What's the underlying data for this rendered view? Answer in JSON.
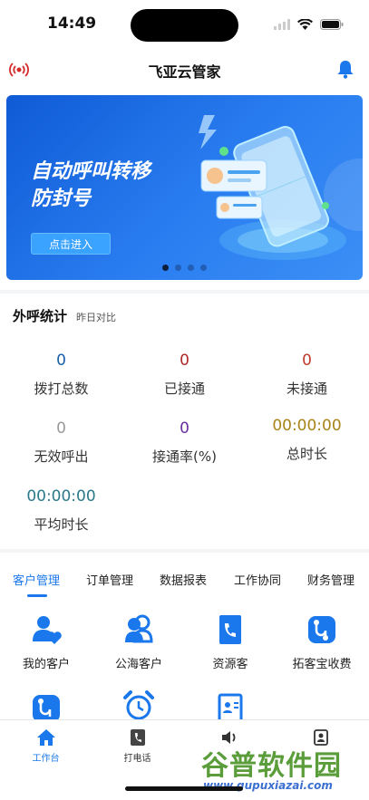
{
  "status_bar": {
    "time": "14:49"
  },
  "nav": {
    "title": "飞亚云管家",
    "left_icon": "broadcast-icon",
    "right_icon": "bell-icon"
  },
  "banner": {
    "headline_line1": "自动呼叫转移",
    "headline_line2": "防封号",
    "button_label": "点击进入",
    "pages": 4,
    "active_page": 1
  },
  "stats": {
    "title": "外呼统计",
    "subtitle": "昨日对比",
    "items": [
      {
        "value": "0",
        "label": "拨打总数",
        "color": "#1a5fa8"
      },
      {
        "value": "0",
        "label": "已接通",
        "color": "#b02a2a"
      },
      {
        "value": "0",
        "label": "未接通",
        "color": "#c0392b"
      },
      {
        "value": "0",
        "label": "无效呼出",
        "color": "#9a9a9a"
      },
      {
        "value": "0",
        "label": "接通率(%)",
        "color": "#6a2fa0"
      },
      {
        "value": "00:00:00",
        "label": "总时长",
        "color": "#a88418"
      },
      {
        "value": "00:00:00",
        "label": "平均时长",
        "color": "#2a7a8a"
      }
    ]
  },
  "tabs": {
    "items": [
      "客户管理",
      "订单管理",
      "数据报表",
      "工作协同",
      "财务管理"
    ],
    "active": 0,
    "accent": "#1b78ec"
  },
  "grid": [
    {
      "label": "我的客户",
      "icon": "customer-heart-icon"
    },
    {
      "label": "公海客户",
      "icon": "people-icon"
    },
    {
      "label": "资源客",
      "icon": "phone-book-icon"
    },
    {
      "label": "拓客宝收费",
      "icon": "route-icon"
    },
    {
      "label": "",
      "icon": "route-icon"
    },
    {
      "label": "",
      "icon": "alarm-clock-icon"
    },
    {
      "label": "",
      "icon": "contact-card-icon"
    }
  ],
  "bottom_tabs": [
    {
      "label": "工作台",
      "icon": "home-icon"
    },
    {
      "label": "打电话",
      "icon": "phone-icon"
    },
    {
      "label": "",
      "icon": "speaker-icon"
    },
    {
      "label": "",
      "icon": "user-icon"
    }
  ],
  "watermark": {
    "main": "谷普软件园",
    "url": "www.gupuxiazai.com"
  }
}
